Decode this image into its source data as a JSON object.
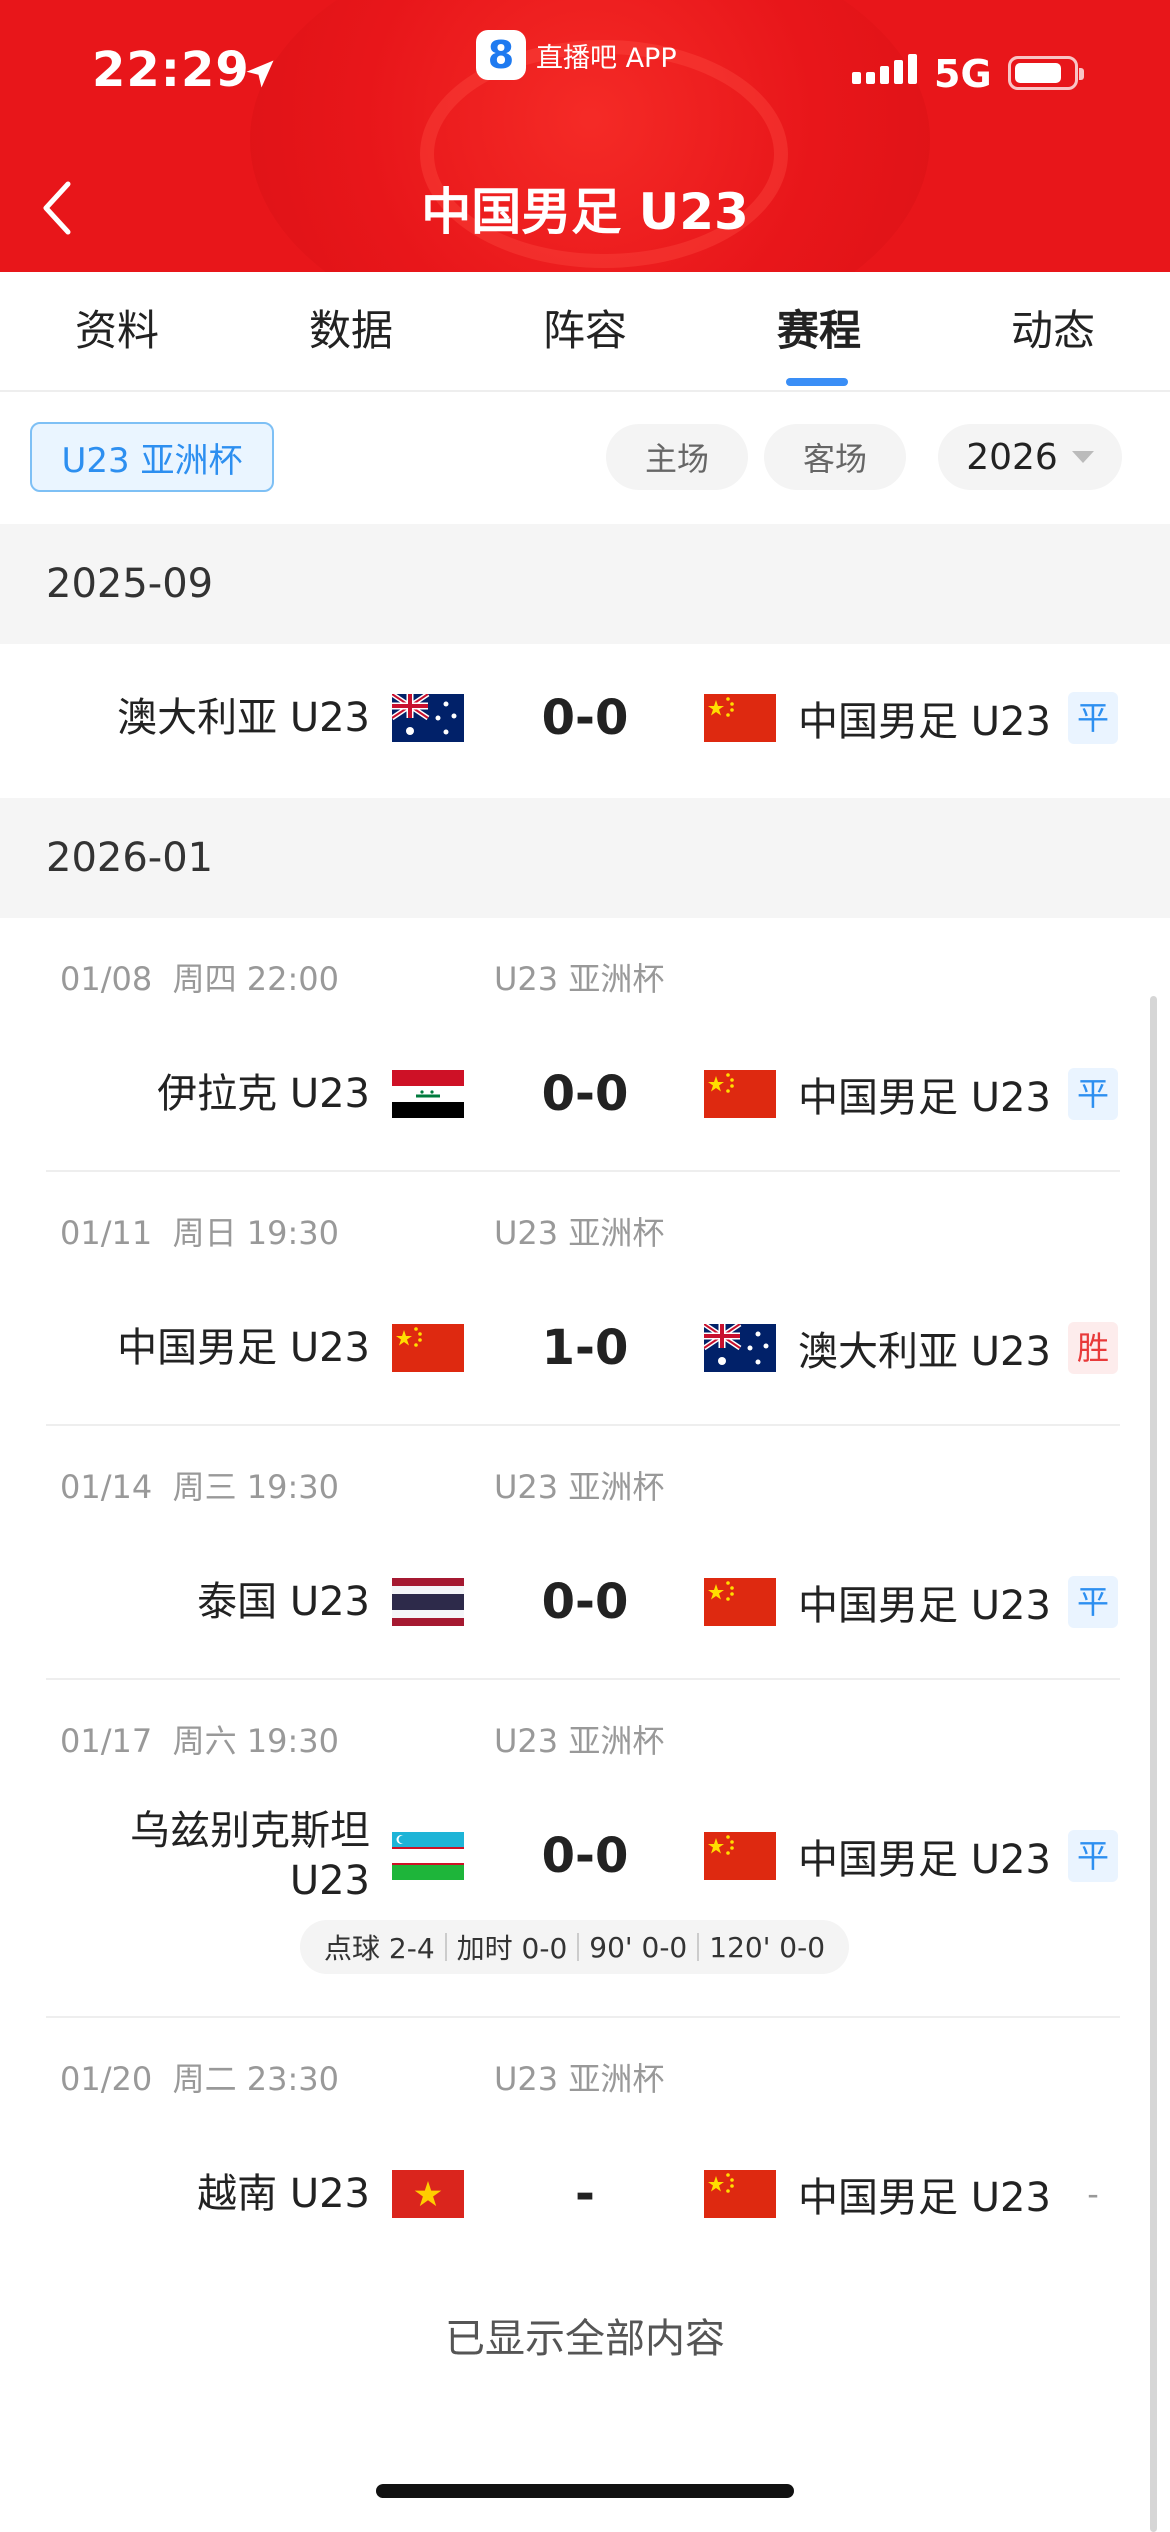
{
  "status_bar": {
    "time": "22:29",
    "network": "5G",
    "app_badge_icon": "8",
    "app_badge": "直播吧 APP"
  },
  "header": {
    "title": "中国男足 U23",
    "color": "#e8161a"
  },
  "tabs": [
    {
      "label": "资料",
      "active": false
    },
    {
      "label": "数据",
      "active": false
    },
    {
      "label": "阵容",
      "active": false
    },
    {
      "label": "赛程",
      "active": true
    },
    {
      "label": "动态",
      "active": false
    }
  ],
  "filters": {
    "competition": "U23 亚洲杯",
    "home": "主场",
    "away": "客场",
    "year": "2026"
  },
  "sections": [
    {
      "month": "2025-09",
      "matches": [
        {
          "home": "澳大利亚 U23",
          "home_flag": "flag-australia",
          "score": "0-0",
          "away": "中国男足 U23",
          "away_flag": "flag-china",
          "result": "平"
        }
      ]
    },
    {
      "month": "2026-01",
      "matches": [
        {
          "date": "01/08",
          "weekday": "周四",
          "time": "22:00",
          "competition": "U23 亚洲杯",
          "home": "伊拉克 U23",
          "home_flag": "flag-iraq",
          "score": "0-0",
          "away": "中国男足 U23",
          "away_flag": "flag-china",
          "result": "平"
        },
        {
          "date": "01/11",
          "weekday": "周日",
          "time": "19:30",
          "competition": "U23 亚洲杯",
          "home": "中国男足 U23",
          "home_flag": "flag-china",
          "score": "1-0",
          "away": "澳大利亚 U23",
          "away_flag": "flag-australia",
          "result": "胜"
        },
        {
          "date": "01/14",
          "weekday": "周三",
          "time": "19:30",
          "competition": "U23 亚洲杯",
          "home": "泰国 U23",
          "home_flag": "flag-thailand",
          "score": "0-0",
          "away": "中国男足 U23",
          "away_flag": "flag-china",
          "result": "平"
        },
        {
          "date": "01/17",
          "weekday": "周六",
          "time": "19:30",
          "competition": "U23 亚洲杯",
          "home_line1": "乌兹别克斯坦",
          "home_line2": "U23",
          "home_flag": "flag-uzbekistan",
          "score": "0-0",
          "away": "中国男足 U23",
          "away_flag": "flag-china",
          "result": "平",
          "details": {
            "penalties": "点球 2-4",
            "extra_time": "加时 0-0",
            "ninety": "90' 0-0",
            "one_twenty": "120' 0-0"
          }
        },
        {
          "date": "01/20",
          "weekday": "周二",
          "time": "23:30",
          "competition": "U23 亚洲杯",
          "home": "越南 U23",
          "home_flag": "flag-vietnam",
          "score": "-",
          "away": "中国男足 U23",
          "away_flag": "flag-china",
          "result": "-"
        }
      ]
    }
  ],
  "footer": {
    "end_text": "已显示全部内容"
  },
  "colors": {
    "accent_blue": "#2d8ff0",
    "win_red": "#e83a3a"
  }
}
